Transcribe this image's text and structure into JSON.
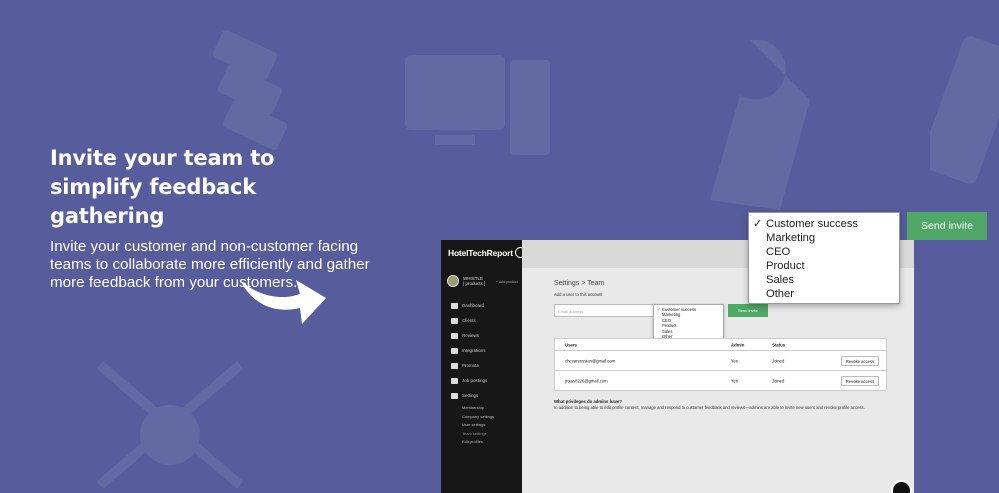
{
  "hero": {
    "title": "Invite your team to simplify feedback gathering",
    "description": "Invite your customer and non-customer facing teams to collaborate more efficiently and gather more feedback from your customers."
  },
  "colors": {
    "background": "#575d9c",
    "accent_green": "#4fa865",
    "sidebar_dark": "#171717"
  },
  "app": {
    "brand": "HotelTechReport",
    "account": {
      "name": "WHISTLE",
      "subtitle": "[ products ]",
      "add_label": "+ Add product"
    },
    "nav": [
      {
        "label": "Dashboard",
        "icon": "home-icon"
      },
      {
        "label": "Clients",
        "icon": "users-icon"
      },
      {
        "label": "Reviews",
        "icon": "chat-icon"
      },
      {
        "label": "Integrations",
        "icon": "share-icon"
      },
      {
        "label": "Promote",
        "icon": "megaphone-icon"
      },
      {
        "label": "Job postings",
        "icon": "mail-icon"
      },
      {
        "label": "Settings",
        "icon": "sliders-icon"
      }
    ],
    "subnav": [
      {
        "label": "Membership"
      },
      {
        "label": "Company settings"
      },
      {
        "label": "User settings"
      },
      {
        "label": "Team settings",
        "active": true
      },
      {
        "label": "Edit profiles"
      }
    ],
    "breadcrumb": "Settings > Team",
    "add_user_label": "Add a user to this account",
    "email_placeholder": "Email address",
    "send_invite_label": "Send invite",
    "role_options": [
      "Customer success",
      "Marketing",
      "CEO",
      "Product",
      "Sales",
      "Other"
    ],
    "selected_role": "Customer success",
    "table": {
      "headers": [
        "Users",
        "Admin",
        "Status"
      ],
      "rows": [
        {
          "email": "chevarenssian@gmail.com",
          "admin": "Yes",
          "status": "Joined",
          "action": "Revoke access"
        },
        {
          "email": "jrojas0226@gmail.com",
          "admin": "Yes",
          "status": "Joined",
          "action": "Revoke access"
        }
      ]
    },
    "faq": {
      "question": "What privileges do admins have?",
      "answer": "In addition to being able to edit profile content, manage and respond to customer feedback and reviews—admins are able to invite new users and revoke profile access."
    }
  },
  "callout": {
    "check_mark": "✓",
    "role_options": [
      "Customer success",
      "Marketing",
      "CEO",
      "Product",
      "Sales",
      "Other"
    ],
    "selected_role": "Customer success",
    "send_invite_label": "Send invite"
  }
}
